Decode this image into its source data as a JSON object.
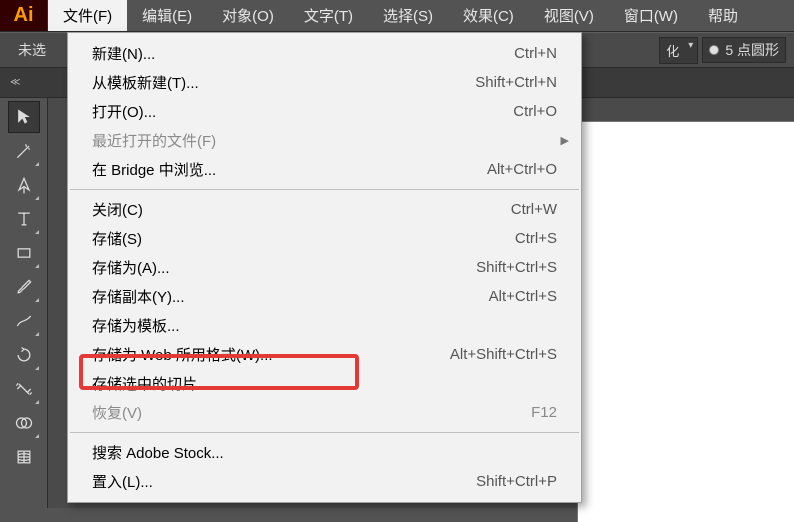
{
  "app_icon": "Ai",
  "menubar": [
    "文件(F)",
    "编辑(E)",
    "对象(O)",
    "文字(T)",
    "选择(S)",
    "效果(C)",
    "视图(V)",
    "窗口(W)",
    "帮助"
  ],
  "active_menu_index": 0,
  "optionsbar": {
    "left_label": "未选",
    "dd1": "化",
    "stroke_label": "5 点圆形"
  },
  "file_menu": [
    {
      "type": "item",
      "label": "新建(N)...",
      "shortcut": "Ctrl+N"
    },
    {
      "type": "item",
      "label": "从模板新建(T)...",
      "shortcut": "Shift+Ctrl+N"
    },
    {
      "type": "item",
      "label": "打开(O)...",
      "shortcut": "Ctrl+O"
    },
    {
      "type": "item",
      "label": "最近打开的文件(F)",
      "shortcut": "",
      "disabled": true,
      "submenu": true
    },
    {
      "type": "item",
      "label": "在 Bridge 中浏览...",
      "shortcut": "Alt+Ctrl+O"
    },
    {
      "type": "sep"
    },
    {
      "type": "item",
      "label": "关闭(C)",
      "shortcut": "Ctrl+W"
    },
    {
      "type": "item",
      "label": "存储(S)",
      "shortcut": "Ctrl+S"
    },
    {
      "type": "item",
      "label": "存储为(A)...",
      "shortcut": "Shift+Ctrl+S"
    },
    {
      "type": "item",
      "label": "存储副本(Y)...",
      "shortcut": "Alt+Ctrl+S"
    },
    {
      "type": "item",
      "label": "存储为模板..."
    },
    {
      "type": "item",
      "label": "存储为 Web 所用格式(W)...",
      "shortcut": "Alt+Shift+Ctrl+S",
      "highlighted": true
    },
    {
      "type": "item",
      "label": "存储选中的切片..."
    },
    {
      "type": "item",
      "label": "恢复(V)",
      "shortcut": "F12",
      "disabled": true
    },
    {
      "type": "sep"
    },
    {
      "type": "item",
      "label": "搜索 Adobe Stock..."
    },
    {
      "type": "item",
      "label": "置入(L)...",
      "shortcut": "Shift+Ctrl+P"
    }
  ]
}
